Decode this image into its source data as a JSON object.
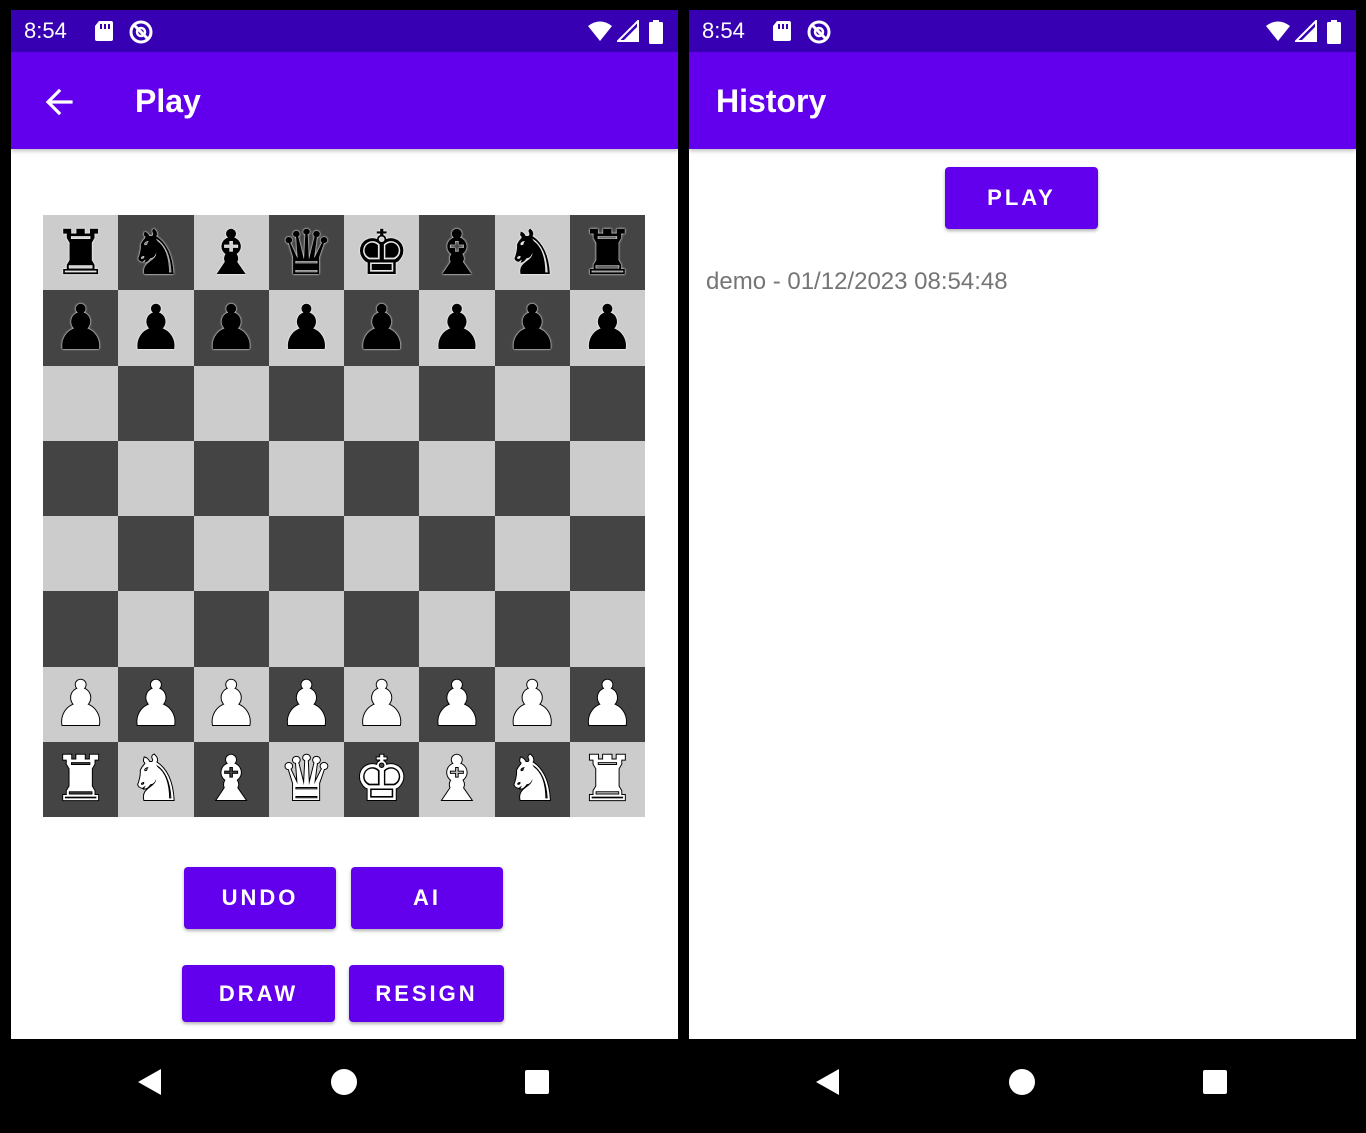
{
  "colors": {
    "status_bar": "#3700b3",
    "app_bar": "#6200ee",
    "button": "#6200ee",
    "light_square": "#cccccc",
    "dark_square": "#444444",
    "history_text": "#757575"
  },
  "play_screen": {
    "status": {
      "time": "8:54",
      "icons": [
        "sd-card-icon",
        "do-not-disturb-icon",
        "wifi-icon",
        "signal-icon",
        "battery-icon"
      ]
    },
    "app_bar": {
      "back_icon": "arrow-back-icon",
      "title": "Play"
    },
    "board": {
      "light_first": true,
      "ranks": [
        [
          "r",
          "n",
          "b",
          "q",
          "k",
          "b",
          "n",
          "r"
        ],
        [
          "p",
          "p",
          "p",
          "p",
          "p",
          "p",
          "p",
          "p"
        ],
        [
          "",
          "",
          "",
          "",
          "",
          "",
          "",
          ""
        ],
        [
          "",
          "",
          "",
          "",
          "",
          "",
          "",
          ""
        ],
        [
          "",
          "",
          "",
          "",
          "",
          "",
          "",
          ""
        ],
        [
          "",
          "",
          "",
          "",
          "",
          "",
          "",
          ""
        ],
        [
          "P",
          "P",
          "P",
          "P",
          "P",
          "P",
          "P",
          "P"
        ],
        [
          "R",
          "N",
          "B",
          "Q",
          "K",
          "B",
          "N",
          "R"
        ]
      ]
    },
    "buttons": {
      "undo": "UNDO",
      "ai": "AI",
      "draw": "DRAW",
      "resign": "RESIGN"
    },
    "nav": [
      "back-triangle-icon",
      "home-circle-icon",
      "recents-square-icon"
    ]
  },
  "history_screen": {
    "status": {
      "time": "8:54",
      "icons": [
        "sd-card-icon",
        "do-not-disturb-icon",
        "wifi-icon",
        "signal-icon",
        "battery-icon"
      ]
    },
    "app_bar": {
      "title": "History"
    },
    "play_button": "PLAY",
    "games": [
      "demo - 01/12/2023 08:54:48"
    ],
    "nav": [
      "back-triangle-icon",
      "home-circle-icon",
      "recents-square-icon"
    ]
  }
}
